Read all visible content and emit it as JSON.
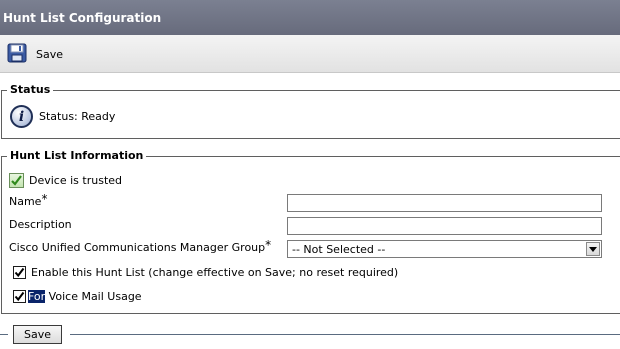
{
  "page": {
    "title": "Hunt List Configuration"
  },
  "toolbar": {
    "save_label": "Save",
    "save_icon": "floppy-disk-icon"
  },
  "status_section": {
    "legend": "Status",
    "icon": "info-icon",
    "text": "Status: Ready"
  },
  "info_section": {
    "legend": "Hunt List Information",
    "device_trusted": {
      "label": "Device is trusted",
      "checked": true
    },
    "name": {
      "label": "Name",
      "required_marker": "*",
      "value": ""
    },
    "description": {
      "label": "Description",
      "value": ""
    },
    "cucm_group": {
      "label": "Cisco Unified Communications Manager Group",
      "required_marker": "*",
      "selected": "-- Not Selected --"
    },
    "enable_hunt_list": {
      "label": "Enable this Hunt List (change effective on Save; no reset required)",
      "checked": true
    },
    "voice_mail": {
      "label_highlighted": "For",
      "label_rest": " Voice Mail Usage",
      "checked": true
    }
  },
  "footer": {
    "save_label": "Save"
  }
}
